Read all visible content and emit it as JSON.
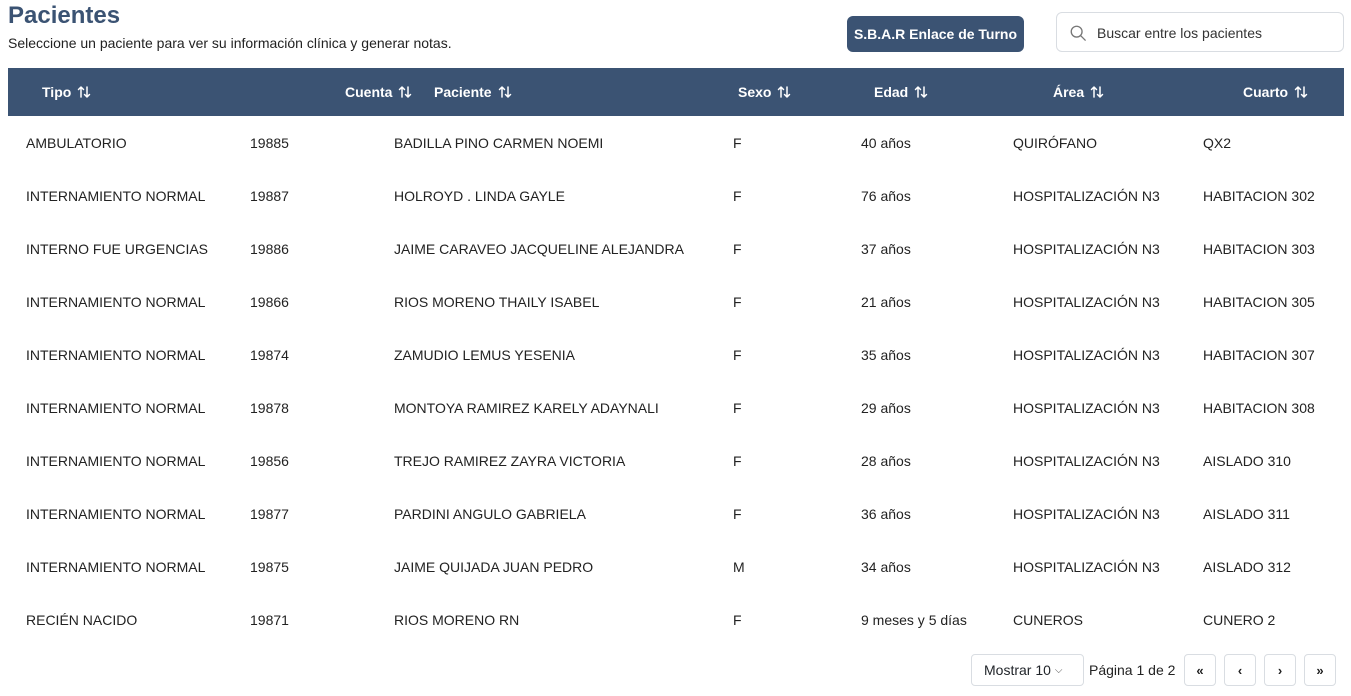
{
  "header": {
    "title": "Pacientes",
    "subtitle": "Seleccione un paciente para ver su información clínica y generar notas.",
    "sbar_button": "S.B.A.R Enlace de Turno",
    "search_placeholder": "Buscar entre los pacientes"
  },
  "table": {
    "columns": [
      "Tipo",
      "Cuenta",
      "Paciente",
      "Sexo",
      "Edad",
      "Área",
      "Cuarto"
    ],
    "rows": [
      [
        "AMBULATORIO",
        "19885",
        "BADILLA PINO CARMEN NOEMI",
        "F",
        "40 años",
        "QUIRÓFANO",
        "QX2"
      ],
      [
        "INTERNAMIENTO NORMAL",
        "19887",
        "HOLROYD . LINDA GAYLE",
        "F",
        "76 años",
        "HOSPITALIZACIÓN N3",
        "HABITACION 302"
      ],
      [
        "INTERNO FUE URGENCIAS",
        "19886",
        "JAIME CARAVEO JACQUELINE ALEJANDRA",
        "F",
        "37 años",
        "HOSPITALIZACIÓN N3",
        "HABITACION 303"
      ],
      [
        "INTERNAMIENTO NORMAL",
        "19866",
        "RIOS MORENO THAILY ISABEL",
        "F",
        "21 años",
        "HOSPITALIZACIÓN N3",
        "HABITACION 305"
      ],
      [
        "INTERNAMIENTO NORMAL",
        "19874",
        "ZAMUDIO LEMUS YESENIA",
        "F",
        "35 años",
        "HOSPITALIZACIÓN N3",
        "HABITACION 307"
      ],
      [
        "INTERNAMIENTO NORMAL",
        "19878",
        "MONTOYA RAMIREZ KARELY ADAYNALI",
        "F",
        "29 años",
        "HOSPITALIZACIÓN N3",
        "HABITACION 308"
      ],
      [
        "INTERNAMIENTO NORMAL",
        "19856",
        "TREJO RAMIREZ ZAYRA VICTORIA",
        "F",
        "28 años",
        "HOSPITALIZACIÓN N3",
        "AISLADO 310"
      ],
      [
        "INTERNAMIENTO NORMAL",
        "19877",
        "PARDINI ANGULO GABRIELA",
        "F",
        "36 años",
        "HOSPITALIZACIÓN N3",
        "AISLADO 311"
      ],
      [
        "INTERNAMIENTO NORMAL",
        "19875",
        "JAIME QUIJADA JUAN PEDRO",
        "M",
        "34 años",
        "HOSPITALIZACIÓN N3",
        "AISLADO 312"
      ],
      [
        "RECIÉN NACIDO",
        "19871",
        "RIOS MORENO RN",
        "F",
        "9 meses y 5 días",
        "CUNEROS",
        "CUNERO 2"
      ]
    ]
  },
  "pagination": {
    "page_size_label": "Mostrar 10",
    "page_info": "Página 1 de 2",
    "first_label": "«",
    "prev_label": "‹",
    "next_label": "›",
    "last_label": "»"
  },
  "colors": {
    "primary": "#3b5373",
    "header_text": "#ffffff"
  },
  "icons": {
    "search": "search-icon",
    "sort": "sort-icon",
    "dropdown": "chevron-down-icon"
  }
}
